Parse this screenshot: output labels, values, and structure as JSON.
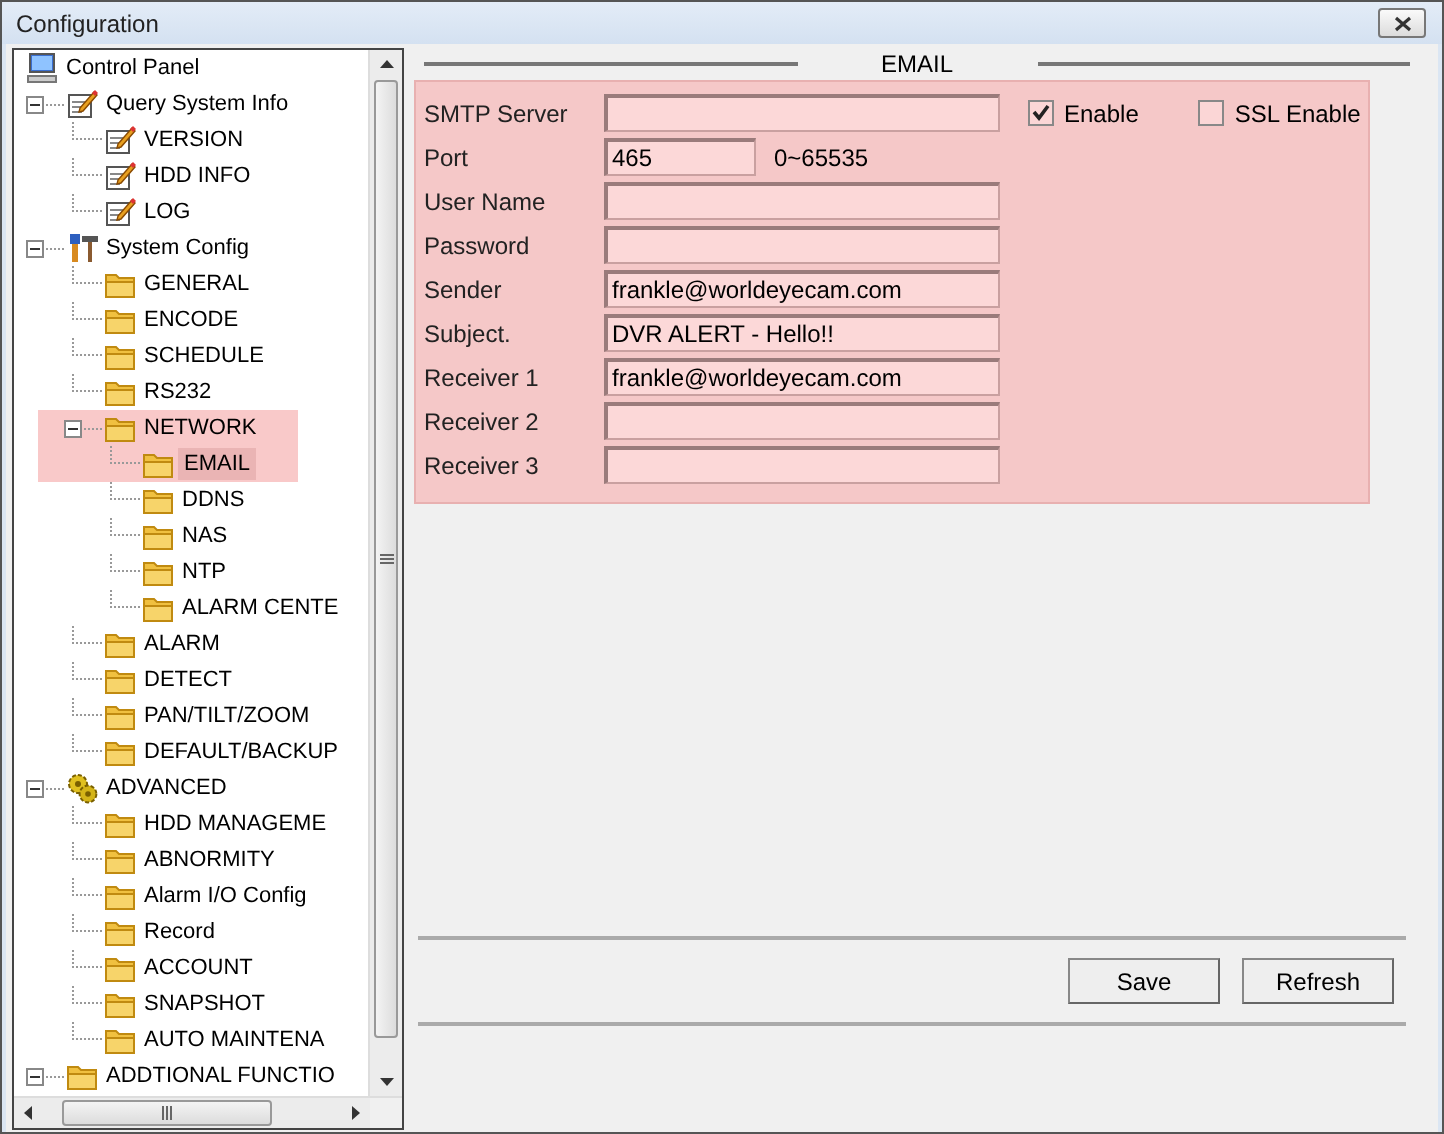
{
  "window": {
    "title": "Configuration"
  },
  "tree": [
    {
      "label": "Control Panel",
      "kind": "computer"
    },
    {
      "label": "Query System Info",
      "kind": "note",
      "expanded": true,
      "children": [
        {
          "label": "VERSION",
          "kind": "note"
        },
        {
          "label": "HDD INFO",
          "kind": "note"
        },
        {
          "label": "LOG",
          "kind": "note"
        }
      ]
    },
    {
      "label": "System Config",
      "kind": "tools",
      "expanded": true,
      "children": [
        {
          "label": "GENERAL",
          "kind": "folder"
        },
        {
          "label": "ENCODE",
          "kind": "folder"
        },
        {
          "label": "SCHEDULE",
          "kind": "folder"
        },
        {
          "label": "RS232",
          "kind": "folder"
        },
        {
          "label": "NETWORK",
          "kind": "folder",
          "expanded": true,
          "highlighted": true,
          "children": [
            {
              "label": "EMAIL",
              "kind": "folder",
              "selected": true,
              "highlighted": true
            },
            {
              "label": "DDNS",
              "kind": "folder",
              "selected": false
            },
            {
              "label": "NAS",
              "kind": "folder",
              "selected": false
            },
            {
              "label": "NTP",
              "kind": "folder",
              "selected": false
            },
            {
              "label": "ALARM CENTE",
              "kind": "folder",
              "selected": false
            }
          ]
        },
        {
          "label": "ALARM",
          "kind": "folder"
        },
        {
          "label": "DETECT",
          "kind": "folder"
        },
        {
          "label": "PAN/TILT/ZOOM",
          "kind": "folder"
        },
        {
          "label": "DEFAULT/BACKUP",
          "kind": "folder"
        }
      ]
    },
    {
      "label": "ADVANCED",
      "kind": "gears",
      "expanded": true,
      "children": [
        {
          "label": "HDD MANAGEME",
          "kind": "folder"
        },
        {
          "label": "ABNORMITY",
          "kind": "folder"
        },
        {
          "label": "Alarm I/O Config",
          "kind": "folder"
        },
        {
          "label": "Record",
          "kind": "folder"
        },
        {
          "label": "ACCOUNT",
          "kind": "folder"
        },
        {
          "label": "SNAPSHOT",
          "kind": "folder"
        },
        {
          "label": "AUTO MAINTENA",
          "kind": "folder"
        }
      ]
    },
    {
      "label": "ADDTIONAL FUNCTIO",
      "kind": "folder",
      "expanded": true
    }
  ],
  "section": {
    "title": "EMAIL",
    "highlighted": true
  },
  "fields": [
    {
      "label": "SMTP Server",
      "kind": "wide"
    },
    {
      "label": "Port",
      "kind": "short",
      "value": "465",
      "hint": "0~65535"
    },
    {
      "label": "User Name",
      "kind": "wide"
    },
    {
      "label": "Password",
      "kind": "wide"
    },
    {
      "label": "Sender",
      "kind": "wide",
      "value": "frankle@worldeyecam.com"
    },
    {
      "label": "Subject.",
      "kind": "wide",
      "value": "DVR ALERT - Hello!!"
    },
    {
      "label": "Receiver 1",
      "kind": "wide",
      "value": "frankle@worldeyecam.com"
    },
    {
      "label": "Receiver 2",
      "kind": "wide"
    },
    {
      "label": "Receiver 3",
      "kind": "wide"
    }
  ],
  "checkboxes": [
    {
      "label": "Enable",
      "checked": true
    },
    {
      "label": "SSL Enable",
      "checked": false
    }
  ],
  "buttons": [
    "Save",
    "Refresh"
  ]
}
